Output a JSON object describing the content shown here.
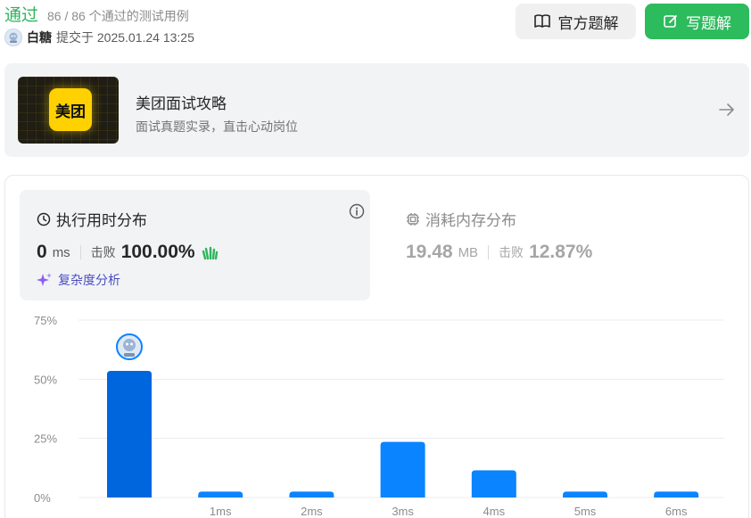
{
  "header": {
    "status": "通过",
    "passed_text": "86 / 86 个通过的测试用例",
    "user_name": "白糖",
    "submitted_text": "提交于 2025.01.24 13:25",
    "official_solution_label": "官方题解",
    "write_solution_label": "写题解"
  },
  "banner": {
    "logo_text": "美团",
    "title": "美团面试攻略",
    "subtitle": "面试真题实录，直击心动岗位"
  },
  "runtime": {
    "title": "执行用时分布",
    "value": "0",
    "unit": "ms",
    "beat_label": "击败",
    "beat_percent": "100.00%",
    "complexity_label": "复杂度分析"
  },
  "memory": {
    "title": "消耗内存分布",
    "value": "19.48",
    "unit": "MB",
    "beat_label": "击败",
    "beat_percent": "12.87%"
  },
  "colors": {
    "accent_green": "#2cbb5d",
    "bar_blue": "#0a84ff",
    "bar_selected": "#0066dd"
  },
  "chart_data": {
    "type": "bar",
    "categories": [
      "",
      "1ms",
      "2ms",
      "3ms",
      "4ms",
      "5ms",
      "6ms"
    ],
    "values": [
      53.5,
      2.5,
      2.5,
      23.5,
      11.5,
      2.5,
      2.5
    ],
    "selected_index": 0,
    "yticks": [
      "0%",
      "25%",
      "50%",
      "75%"
    ],
    "ylim": [
      0,
      75
    ],
    "grid": true
  }
}
